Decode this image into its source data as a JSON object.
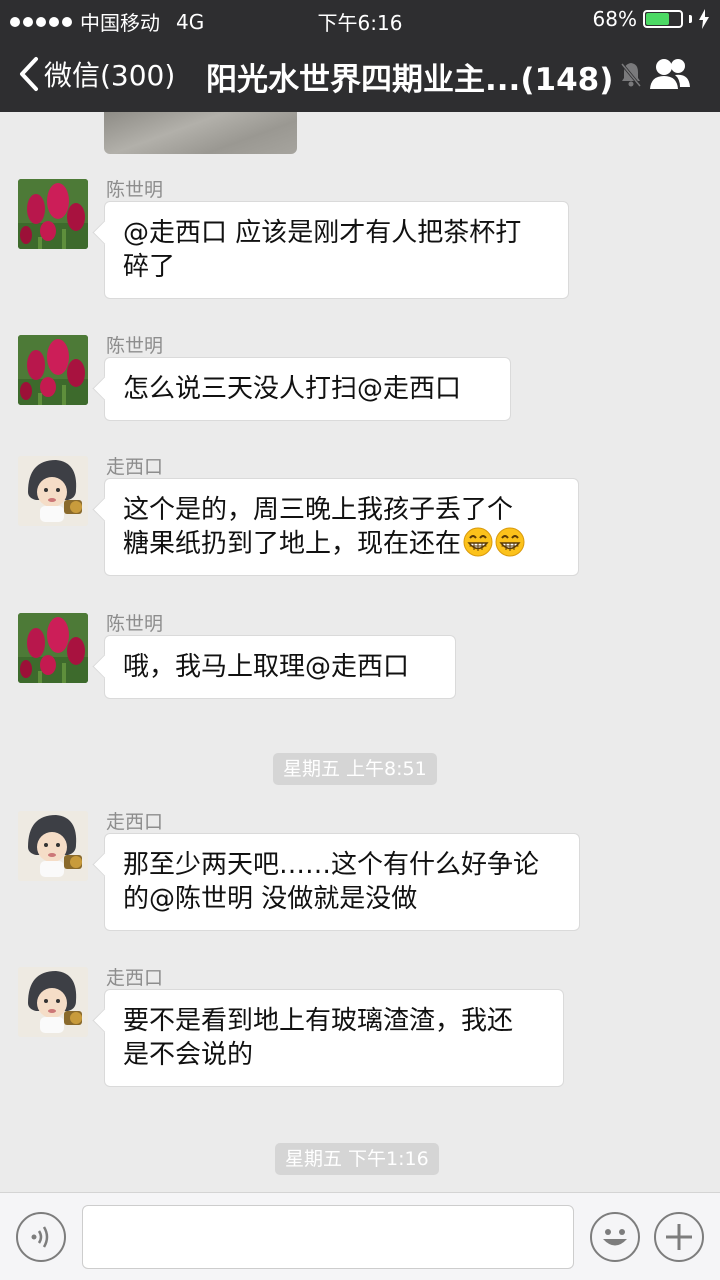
{
  "status_bar": {
    "carrier": "中国移动",
    "network": "4G",
    "time": "下午6:16",
    "battery_text": "68%",
    "battery_level": 0.68
  },
  "nav": {
    "back_label": "微信(300)",
    "title": "阳光水世界四期业主...(148)",
    "mute_icon": "mute-bell-icon",
    "members_icon": "group-members-icon"
  },
  "messages": [
    {
      "sender": "陈世明",
      "avatar": "flower",
      "text": "@走西口 应该是刚才有人把茶杯打碎了",
      "lines": [
        "@走西口 应该是刚才有人把茶杯打",
        "碎了"
      ]
    },
    {
      "sender": "陈世明",
      "avatar": "flower",
      "text": "怎么说三天没人打扫@走西口",
      "lines": [
        "怎么说三天没人打扫@走西口"
      ]
    },
    {
      "sender": "走西口",
      "avatar": "baby",
      "text": "这个是的，周三晚上我孩子丢了个糖果纸扔到了地上，现在还在",
      "lines": [
        "这个是的，周三晚上我孩子丢了个",
        "糖果纸扔到了地上，现在还在"
      ],
      "emoji": [
        "grinning-face",
        "grinning-face"
      ]
    },
    {
      "sender": "陈世明",
      "avatar": "flower",
      "text": "哦，我马上取理@走西口",
      "lines": [
        "哦，我马上取理@走西口"
      ]
    },
    {
      "sender": "走西口",
      "avatar": "baby",
      "text": "那至少两天吧……这个有什么好争论的@陈世明 没做就是没做",
      "lines": [
        "那至少两天吧……这个有什么好争论",
        "的@陈世明 没做就是没做"
      ]
    },
    {
      "sender": "走西口",
      "avatar": "baby",
      "text": "要不是看到地上有玻璃渣渣，我还是不会说的",
      "lines": [
        "要不是看到地上有玻璃渣渣，我还",
        "是不会说的"
      ]
    }
  ],
  "timestamps": [
    "星期五 上午8:51",
    "星期五 下午1:16"
  ],
  "input_bar": {
    "placeholder": "",
    "voice_icon": "voice-icon",
    "emoji_icon": "emoji-icon",
    "plus_icon": "plus-icon"
  },
  "colors": {
    "header_bg": "#2e2e30",
    "chat_bg": "#ebebeb",
    "bubble_bg": "#ffffff",
    "battery_fill": "#4cd964",
    "timestamp_bg": "#d5d5d5"
  }
}
